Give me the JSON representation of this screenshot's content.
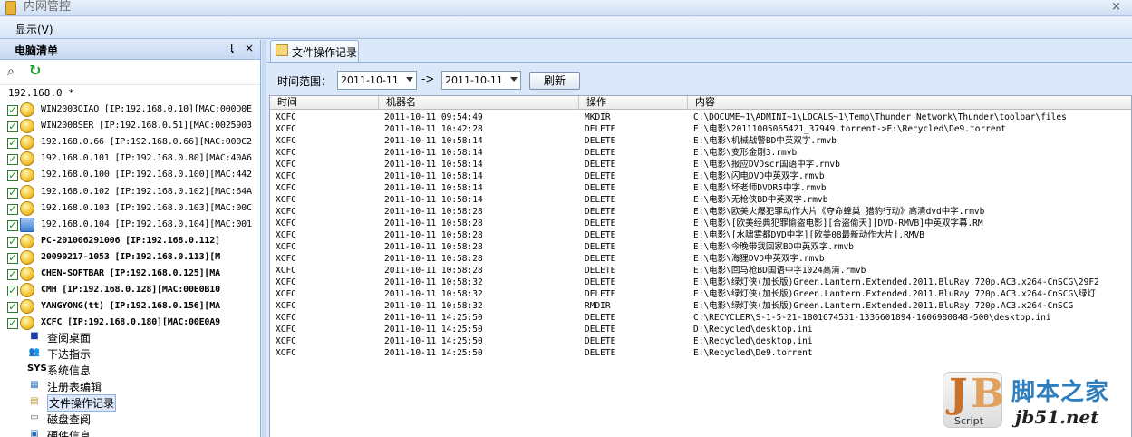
{
  "window": {
    "title": "内网管控",
    "close": "×"
  },
  "menu": {
    "items": [
      "显示(V)"
    ]
  },
  "left_panel": {
    "title": "电脑清单",
    "pin": "Ҭ",
    "close": "×",
    "root": "192.168.0 *",
    "computers": [
      {
        "label": "WIN2003QIAO [IP:192.168.0.10][MAC:000D0E",
        "bold": false,
        "icon": "face"
      },
      {
        "label": "WIN2008SER [IP:192.168.0.51][MAC:0025903",
        "bold": false,
        "icon": "face"
      },
      {
        "label": "192.168.0.66 [IP:192.168.0.66][MAC:000C2",
        "bold": false,
        "icon": "face"
      },
      {
        "label": "192.168.0.101 [IP:192.168.0.80][MAC:40A6",
        "bold": false,
        "icon": "face"
      },
      {
        "label": "192.168.0.100 [IP:192.168.0.100][MAC:442",
        "bold": false,
        "icon": "face"
      },
      {
        "label": "192.168.0.102 [IP:192.168.0.102][MAC:64A",
        "bold": false,
        "icon": "face"
      },
      {
        "label": "192.168.0.103 [IP:192.168.0.103][MAC:00C",
        "bold": false,
        "icon": "face"
      },
      {
        "label": "192.168.0.104 [IP:192.168.0.104][MAC:001",
        "bold": false,
        "icon": "pc"
      },
      {
        "label": "PC-201006291006 [IP:192.168.0.112]",
        "bold": true,
        "icon": "face"
      },
      {
        "label": "20090217-1053 [IP:192.168.0.113][M",
        "bold": true,
        "icon": "face"
      },
      {
        "label": "CHEN-SOFTBAR [IP:192.168.0.125][MA",
        "bold": true,
        "icon": "face"
      },
      {
        "label": "CMH [IP:192.168.0.128][MAC:00E0B10",
        "bold": true,
        "icon": "face"
      },
      {
        "label": "YANGYONG(tt) [IP:192.168.0.156][MA",
        "bold": true,
        "icon": "face"
      },
      {
        "label": "XCFC [IP:192.168.0.180][MAC:00E0A9",
        "bold": true,
        "icon": "face"
      }
    ],
    "functions": [
      {
        "label": "查阅桌面",
        "icon": "■",
        "color": "#1a3fa8"
      },
      {
        "label": "下达指示",
        "icon": "👥",
        "color": "#333"
      },
      {
        "label": "系统信息",
        "icon": "SYS",
        "color": "#000"
      },
      {
        "label": "注册表编辑",
        "icon": "▦",
        "color": "#2c6fb5"
      },
      {
        "label": "文件操作记录",
        "icon": "▤",
        "color": "#b9902f",
        "selected": true
      },
      {
        "label": "磁盘查阅",
        "icon": "▭",
        "color": "#555"
      },
      {
        "label": "硬件信息",
        "icon": "▣",
        "color": "#2c6fb5"
      }
    ]
  },
  "tab": {
    "label": "文件操作记录"
  },
  "filter": {
    "label": "时间范围：",
    "from": "2011-10-11",
    "arrow": "->",
    "to": "2011-10-11",
    "refresh": "刷新"
  },
  "grid": {
    "columns": [
      "时间",
      "机器名",
      "操作",
      "内容"
    ],
    "rows": [
      [
        "XCFC",
        "2011-10-11 09:54:49",
        "MKDIR",
        "C:\\DOCUME~1\\ADMINI~1\\LOCALS~1\\Temp\\Thunder Network\\Thunder\\toolbar\\files"
      ],
      [
        "XCFC",
        "2011-10-11 10:42:28",
        "DELETE",
        "E:\\电影\\20111005065421_37949.torrent->E:\\Recycled\\De9.torrent"
      ],
      [
        "XCFC",
        "2011-10-11 10:58:14",
        "DELETE",
        "E:\\电影\\机械战警BD中英双字.rmvb"
      ],
      [
        "XCFC",
        "2011-10-11 10:58:14",
        "DELETE",
        "E:\\电影\\变形金刚3.rmvb"
      ],
      [
        "XCFC",
        "2011-10-11 10:58:14",
        "DELETE",
        "E:\\电影\\报应DVDscr国语中字.rmvb"
      ],
      [
        "XCFC",
        "2011-10-11 10:58:14",
        "DELETE",
        "E:\\电影\\闪电DVD中英双字.rmvb"
      ],
      [
        "XCFC",
        "2011-10-11 10:58:14",
        "DELETE",
        "E:\\电影\\坏老师DVDR5中字.rmvb"
      ],
      [
        "XCFC",
        "2011-10-11 10:58:14",
        "DELETE",
        "E:\\电影\\无枪侠BD中英双字.rmvb"
      ],
      [
        "XCFC",
        "2011-10-11 10:58:28",
        "DELETE",
        "E:\\电影\\欧美火爆犯罪动作大片《夺命蜂巢 猎豹行动》高清dvd中字.rmvb"
      ],
      [
        "XCFC",
        "2011-10-11 10:58:28",
        "DELETE",
        "E:\\电影\\[欧美经典犯罪偷盗电影][合盗偷天][DVD-RMVB]中英双字幕.RM"
      ],
      [
        "XCFC",
        "2011-10-11 10:58:28",
        "DELETE",
        "E:\\电影\\[水啸雾都DVD中字][欧美08最新动作大片].RMVB"
      ],
      [
        "XCFC",
        "2011-10-11 10:58:28",
        "DELETE",
        "E:\\电影\\今晚带我回家BD中英双字.rmvb"
      ],
      [
        "XCFC",
        "2011-10-11 10:58:28",
        "DELETE",
        "E:\\电影\\海狸DVD中英双字.rmvb"
      ],
      [
        "XCFC",
        "2011-10-11 10:58:28",
        "DELETE",
        "E:\\电影\\回马枪BD国语中字1024高清.rmvb"
      ],
      [
        "XCFC",
        "2011-10-11 10:58:32",
        "DELETE",
        "E:\\电影\\绿灯侠(加长版)Green.Lantern.Extended.2011.BluRay.720p.AC3.x264-CnSCG\\29F2"
      ],
      [
        "XCFC",
        "2011-10-11 10:58:32",
        "DELETE",
        "E:\\电影\\绿灯侠(加长版)Green.Lantern.Extended.2011.BluRay.720p.AC3.x264-CnSCG\\绿灯"
      ],
      [
        "XCFC",
        "2011-10-11 10:58:32",
        "RMDIR",
        "E:\\电影\\绿灯侠(加长版)Green.Lantern.Extended.2011.BluRay.720p.AC3.x264-CnSCG"
      ],
      [
        "XCFC",
        "2011-10-11 14:25:50",
        "DELETE",
        "C:\\RECYCLER\\S-1-5-21-1801674531-1336601894-1606980848-500\\desktop.ini"
      ],
      [
        "XCFC",
        "2011-10-11 14:25:50",
        "DELETE",
        "D:\\Recycled\\desktop.ini"
      ],
      [
        "XCFC",
        "2011-10-11 14:25:50",
        "DELETE",
        "E:\\Recycled\\desktop.ini"
      ],
      [
        "XCFC",
        "2011-10-11 14:25:50",
        "DELETE",
        "E:\\Recycled\\De9.torrent"
      ]
    ]
  },
  "watermark": {
    "script": "Script",
    "cn": "脚本之家",
    "url": "jb51.net"
  }
}
